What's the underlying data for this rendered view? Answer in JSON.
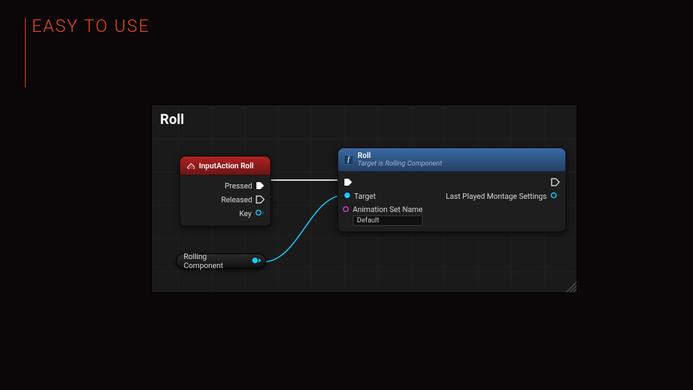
{
  "slide": {
    "title": "EASY TO USE"
  },
  "graph": {
    "title": "Roll"
  },
  "nodes": {
    "inputAction": {
      "title": "InputAction Roll",
      "pins": {
        "pressed": "Pressed",
        "released": "Released",
        "key": "Key"
      }
    },
    "rollFunc": {
      "title": "Roll",
      "subtitle": "Target is Rolling Component",
      "pins": {
        "target": "Target",
        "animSetName": "Animation Set Name",
        "animSetValue": "Default",
        "lastPlayed": "Last Played Montage Settings"
      }
    },
    "variable": {
      "label": "Rolling Component"
    }
  }
}
